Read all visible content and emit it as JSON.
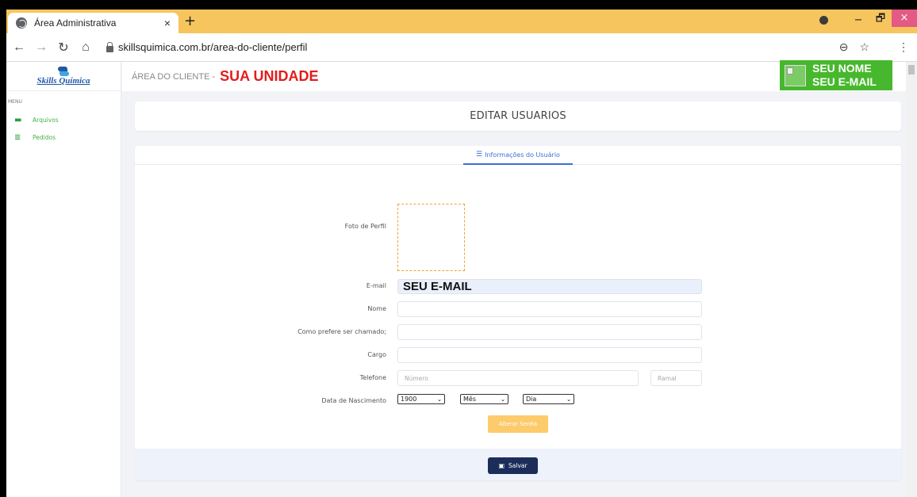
{
  "browser": {
    "tab_title": "Área Administrativa",
    "tab_close": "×",
    "new_tab": "+",
    "url": "skillsquimica.com.br/area-do-cliente/perfil",
    "window": {
      "minimize": "−",
      "maximize": "🗗",
      "close": "×"
    }
  },
  "sidebar": {
    "logo_text": "Skills Química",
    "menu_label": "MENU",
    "items": [
      {
        "label": "Arquivos",
        "icon": "folder-icon"
      },
      {
        "label": "Pedidos",
        "icon": "database-icon"
      }
    ]
  },
  "header": {
    "area_label": "ÁREA DO CLIENTE -",
    "unit": "SUA UNIDADE",
    "user_name": "SEU NOME",
    "user_email": "SEU E-MAIL"
  },
  "page_title": "EDITAR USUARIOS",
  "tab": {
    "label": "Informações do Usuário",
    "icon": "list-icon"
  },
  "form": {
    "photo_label": "Foto de Perfil",
    "email_label": "E-mail",
    "email_value": "SEU E-MAIL",
    "name_label": "Nome",
    "nickname_label": "Como prefere ser chamado;",
    "role_label": "Cargo",
    "phone_label": "Telefone",
    "phone_placeholder": "Número",
    "ext_placeholder": "Ramal",
    "birth_label": "Data de Nascimento",
    "year_value": "1900",
    "month_value": "Mês",
    "day_value": "Dia",
    "change_password": "Alterar Senha",
    "save": "Salvar"
  },
  "colors": {
    "accent_green": "#47b82d",
    "unit_red": "#e41c1c",
    "save_navy": "#1c2d5a",
    "password_orange": "#fdcb6b",
    "tab_blue": "#3b6fd6"
  }
}
